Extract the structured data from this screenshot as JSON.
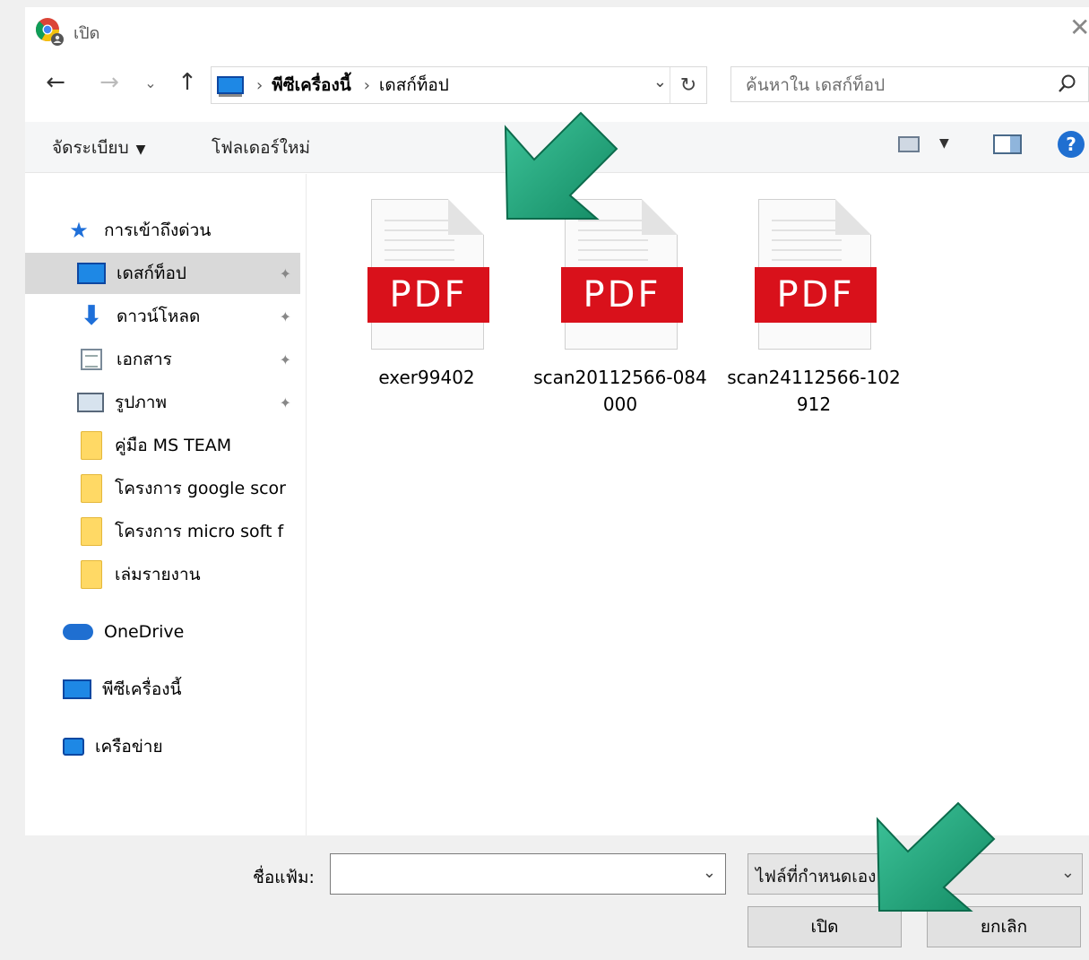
{
  "window": {
    "title": "เปิด",
    "close_symbol": "✕"
  },
  "nav": {
    "back_symbol": "←",
    "forward_symbol": "→",
    "recent_symbol": "⌄",
    "up_symbol": "↑",
    "breadcrumb": [
      "พีซีเครื่องนี้",
      "เดสก์ท็อป"
    ],
    "breadcrumb_separator": "›",
    "address_dropdown_symbol": "⌄",
    "refresh_symbol": "↻"
  },
  "search": {
    "placeholder": "ค้นหาใน เดสก์ท็อป",
    "icon": "search-icon"
  },
  "toolbar": {
    "organize_label": "จัดระเบียบ",
    "organize_caret": "▼",
    "new_folder_label": "โฟลเดอร์ใหม่",
    "view_caret": "▼",
    "help_symbol": "?"
  },
  "sidebar": {
    "items": [
      {
        "label": "การเข้าถึงด่วน",
        "icon": "star-icon"
      },
      {
        "label": "เดสก์ท็อป",
        "icon": "desktop-icon",
        "pinned": true,
        "selected": true
      },
      {
        "label": "ดาวน์โหลด",
        "icon": "download-icon",
        "pinned": true
      },
      {
        "label": "เอกสาร",
        "icon": "document-icon",
        "pinned": true
      },
      {
        "label": "รูปภาพ",
        "icon": "picture-icon",
        "pinned": true
      },
      {
        "label": "คู่มือ MS TEAM",
        "icon": "folder-icon"
      },
      {
        "label": "โครงการ google scor",
        "icon": "folder-icon"
      },
      {
        "label": "โครงการ micro soft f",
        "icon": "folder-icon"
      },
      {
        "label": "เล่มรายงาน",
        "icon": "folder-icon"
      },
      {
        "label": "OneDrive",
        "icon": "cloud-icon"
      },
      {
        "label": "พีซีเครื่องนี้",
        "icon": "pc-icon"
      },
      {
        "label": "เครือข่าย",
        "icon": "network-icon"
      }
    ],
    "pin_symbol": "📌"
  },
  "files": [
    {
      "name": "exer99402",
      "badge": "PDF"
    },
    {
      "name": "scan20112566-084000",
      "badge": "PDF"
    },
    {
      "name": "scan24112566-102912",
      "badge": "PDF"
    }
  ],
  "bottom": {
    "filename_label": "ชื่อแฟ้ม:",
    "filename_value": "",
    "filename_caret": "⌄",
    "filetype_value": "ไฟล์ที่กำหนดเอง",
    "filetype_caret": "⌄",
    "open_label": "เปิด",
    "cancel_label": "ยกเลิก"
  },
  "colors": {
    "accent": "#1e6fd9",
    "pdf_red": "#d9111b",
    "arrow_green": "#1fa67a",
    "selected_bg": "#d9d9d9"
  }
}
